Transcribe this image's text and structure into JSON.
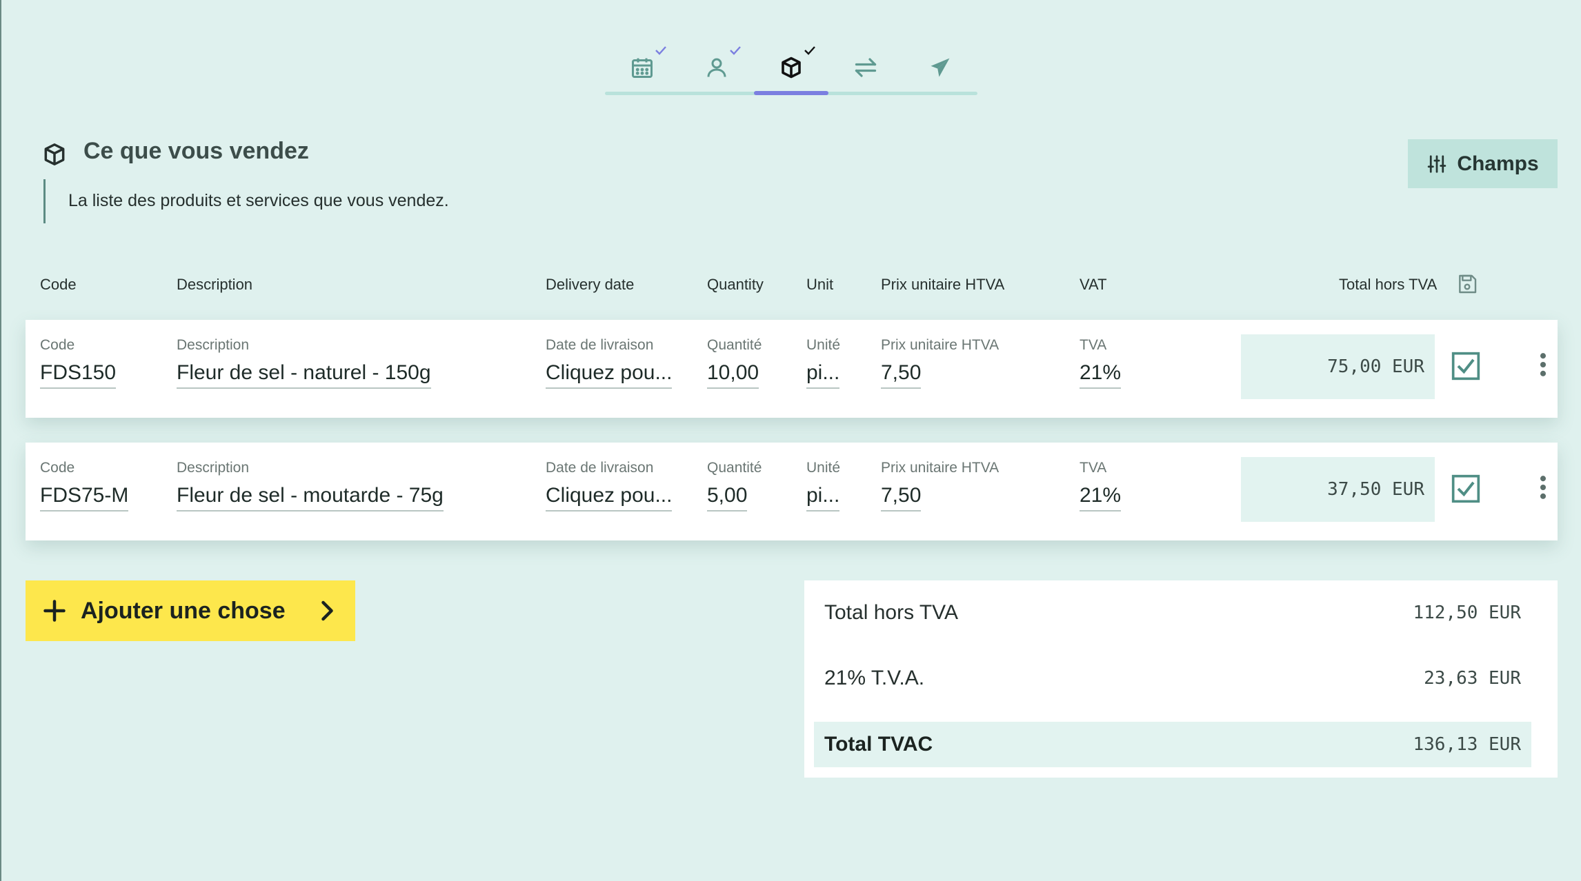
{
  "stepper": {
    "steps": [
      {
        "icon": "calendar-icon",
        "completed": true,
        "active": false
      },
      {
        "icon": "user-icon",
        "completed": true,
        "active": false
      },
      {
        "icon": "box-icon",
        "completed": true,
        "active": true
      },
      {
        "icon": "transfer-arrows-icon",
        "completed": false,
        "active": false
      },
      {
        "icon": "send-paper-plane-icon",
        "completed": false,
        "active": false
      }
    ]
  },
  "section": {
    "title": "Ce que vous vendez",
    "description": "La liste des produits et services que vous vendez.",
    "fields_button": "Champs"
  },
  "columns": {
    "code": "Code",
    "description": "Description",
    "delivery_date": "Delivery date",
    "quantity": "Quantity",
    "unit": "Unit",
    "unit_price": "Prix unitaire HTVA",
    "vat": "VAT",
    "total": "Total hors TVA"
  },
  "rows": [
    {
      "labels": {
        "code": "Code",
        "description": "Description",
        "delivery_date": "Date de livraison",
        "quantity": "Quantité",
        "unit": "Unité",
        "unit_price": "Prix unitaire HTVA",
        "vat": "TVA"
      },
      "code": "FDS150",
      "description": "Fleur de sel - naturel - 150g",
      "delivery_date": "Cliquez pou...",
      "quantity": "10,00",
      "unit": "pi...",
      "unit_price": "7,50",
      "vat": "21%",
      "total": "75,00 EUR",
      "checked": true
    },
    {
      "labels": {
        "code": "Code",
        "description": "Description",
        "delivery_date": "Date de livraison",
        "quantity": "Quantité",
        "unit": "Unité",
        "unit_price": "Prix unitaire HTVA",
        "vat": "TVA"
      },
      "code": "FDS75-M",
      "description": "Fleur de sel - moutarde - 75g",
      "delivery_date": "Cliquez pou...",
      "quantity": "5,00",
      "unit": "pi...",
      "unit_price": "7,50",
      "vat": "21%",
      "total": "37,50 EUR",
      "checked": true
    }
  ],
  "add_button": "Ajouter une chose",
  "summary": {
    "subtotal_label": "Total hors TVA",
    "subtotal_value": "112,50 EUR",
    "vat_label": "21% T.V.A.",
    "vat_value": "23,63 EUR",
    "total_label": "Total TVAC",
    "total_value": "136,13 EUR"
  },
  "colors": {
    "background": "#dff1ee",
    "accent": "#7b7fe0",
    "add_button": "#fde74c",
    "icon_teal": "#5f9a91"
  }
}
